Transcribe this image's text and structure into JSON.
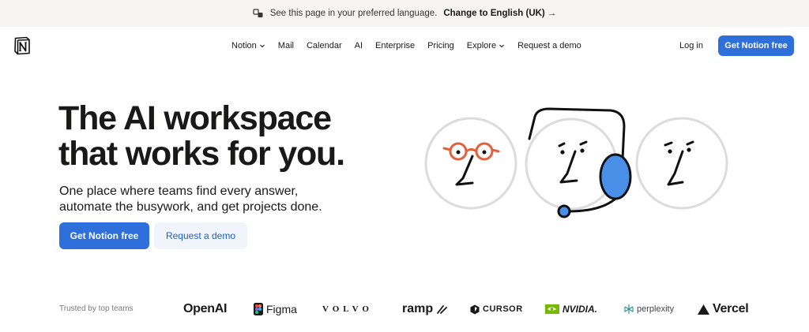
{
  "banner": {
    "message": "See this page in your preferred language.",
    "link_label": "Change to English (UK)",
    "link_arrow": "→"
  },
  "nav": {
    "items": [
      {
        "label": "Notion",
        "has_dropdown": true
      },
      {
        "label": "Mail",
        "has_dropdown": false
      },
      {
        "label": "Calendar",
        "has_dropdown": false
      },
      {
        "label": "AI",
        "has_dropdown": false
      },
      {
        "label": "Enterprise",
        "has_dropdown": false
      },
      {
        "label": "Pricing",
        "has_dropdown": false
      },
      {
        "label": "Explore",
        "has_dropdown": true
      },
      {
        "label": "Request a demo",
        "has_dropdown": false
      }
    ],
    "login_label": "Log in",
    "cta_label": "Get Notion free"
  },
  "hero": {
    "title_line1": "The AI workspace",
    "title_line2": "that works for you.",
    "subtitle_line1": "One place where teams find every answer,",
    "subtitle_line2": "automate the busywork, and get projects done.",
    "primary_button": "Get Notion free",
    "secondary_button": "Request a demo"
  },
  "trusted": {
    "label": "Trusted by top teams",
    "logos": [
      "OpenAI",
      "Figma",
      "VOLVO",
      "ramp",
      "CURSOR",
      "NVIDIA.",
      "perplexity",
      "Vercel"
    ]
  },
  "colors": {
    "accent": "#2f6fdb",
    "banner_bg": "#f6f5f4",
    "secondary_bg": "#f1f5fb",
    "illustration_orange": "#e2603b",
    "illustration_blue": "#4a8fe7"
  }
}
